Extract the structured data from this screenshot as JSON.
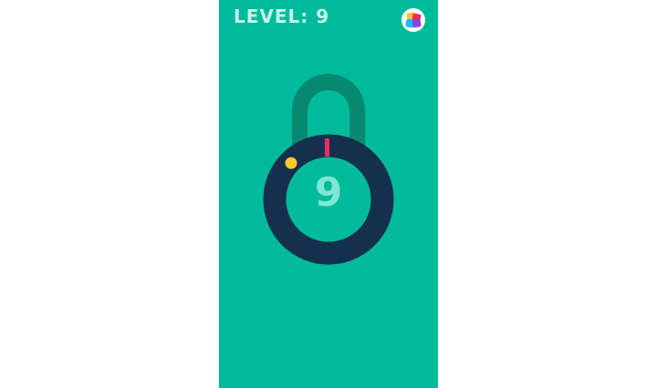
{
  "game": {
    "level_text": "LEVEL: 9",
    "lock_count": "9"
  },
  "colors": {
    "background": "#00bb9b",
    "shackle": "#078870",
    "lock_ring": "#15304c",
    "target_dot": "#f7c82a",
    "needle": "#f0295a",
    "number": "#7fe6d2",
    "header_text": "#c6f6ec"
  },
  "icons": {
    "menu": "colorful-squares-icon"
  }
}
